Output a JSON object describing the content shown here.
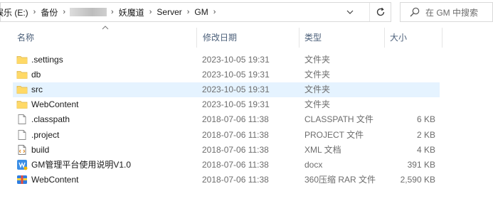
{
  "address": {
    "crumbs": [
      "娱乐 (E:)",
      "备份",
      "",
      "妖魔道",
      "Server",
      "GM"
    ],
    "refresh_icon": "refresh-icon",
    "dropdown_icon": "chevron-down-icon"
  },
  "search": {
    "placeholder": "在 GM 中搜索",
    "icon": "search-icon"
  },
  "columns": {
    "name": "名称",
    "date": "修改日期",
    "type": "类型",
    "size": "大小"
  },
  "files": [
    {
      "name": ".settings",
      "date": "2023-10-05 19:31",
      "type": "文件夹",
      "size": "",
      "icon": "folder-icon"
    },
    {
      "name": "db",
      "date": "2023-10-05 19:31",
      "type": "文件夹",
      "size": "",
      "icon": "folder-icon"
    },
    {
      "name": "src",
      "date": "2023-10-05 19:31",
      "type": "文件夹",
      "size": "",
      "icon": "folder-icon"
    },
    {
      "name": "WebContent",
      "date": "2023-10-05 19:31",
      "type": "文件夹",
      "size": "",
      "icon": "folder-icon"
    },
    {
      "name": ".classpath",
      "date": "2018-07-06 11:38",
      "type": "CLASSPATH 文件",
      "size": "6 KB",
      "icon": "file-icon"
    },
    {
      "name": ".project",
      "date": "2018-07-06 11:38",
      "type": "PROJECT 文件",
      "size": "2 KB",
      "icon": "file-icon"
    },
    {
      "name": "build",
      "date": "2018-07-06 11:38",
      "type": "XML 文档",
      "size": "4 KB",
      "icon": "xml-file-icon"
    },
    {
      "name": "GM管理平台使用说明V1.0",
      "date": "2018-07-06 11:38",
      "type": "docx",
      "size": "391 KB",
      "icon": "docx-file-icon"
    },
    {
      "name": "WebContent",
      "date": "2018-07-06 11:38",
      "type": "360压缩 RAR 文件",
      "size": "2,590 KB",
      "icon": "rar-archive-icon"
    }
  ],
  "hover_row_index": 2,
  "colors": {
    "hover_bg": "#e5f3ff",
    "header_text": "#4c607a",
    "folder": "#f8d775"
  }
}
